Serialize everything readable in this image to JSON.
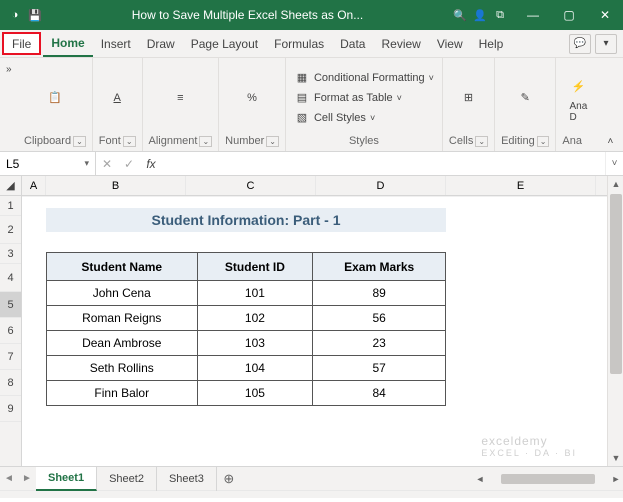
{
  "title": "How to Save Multiple Excel Sheets as On...",
  "tabs": {
    "file": "File",
    "home": "Home",
    "insert": "Insert",
    "draw": "Draw",
    "page_layout": "Page Layout",
    "formulas": "Formulas",
    "data": "Data",
    "review": "Review",
    "view": "View",
    "help": "Help"
  },
  "ribbon": {
    "clipboard": "Clipboard",
    "font": "Font",
    "alignment": "Alignment",
    "number": "Number",
    "styles": "Styles",
    "cond_fmt": "Conditional Formatting",
    "fmt_table": "Format as Table",
    "cell_styles": "Cell Styles",
    "cells": "Cells",
    "editing": "Editing",
    "analyze": "Ana",
    "analyze2": "D",
    "analyze_label": "Ana"
  },
  "namebox": "L5",
  "fx": "fx",
  "columns": [
    "A",
    "B",
    "C",
    "D",
    "E"
  ],
  "rows": [
    "1",
    "2",
    "3",
    "4",
    "5",
    "6",
    "7",
    "8",
    "9"
  ],
  "content": {
    "title": "Student Information: Part - 1",
    "headers": [
      "Student Name",
      "Student ID",
      "Exam Marks"
    ],
    "data": [
      [
        "John Cena",
        "101",
        "89"
      ],
      [
        "Roman Reigns",
        "102",
        "56"
      ],
      [
        "Dean Ambrose",
        "103",
        "23"
      ],
      [
        "Seth Rollins",
        "104",
        "57"
      ],
      [
        "Finn Balor",
        "105",
        "84"
      ]
    ]
  },
  "watermark": {
    "main": "exceldemy",
    "sub": "EXCEL · DA · BI"
  },
  "sheets": [
    "Sheet1",
    "Sheet2",
    "Sheet3"
  ]
}
